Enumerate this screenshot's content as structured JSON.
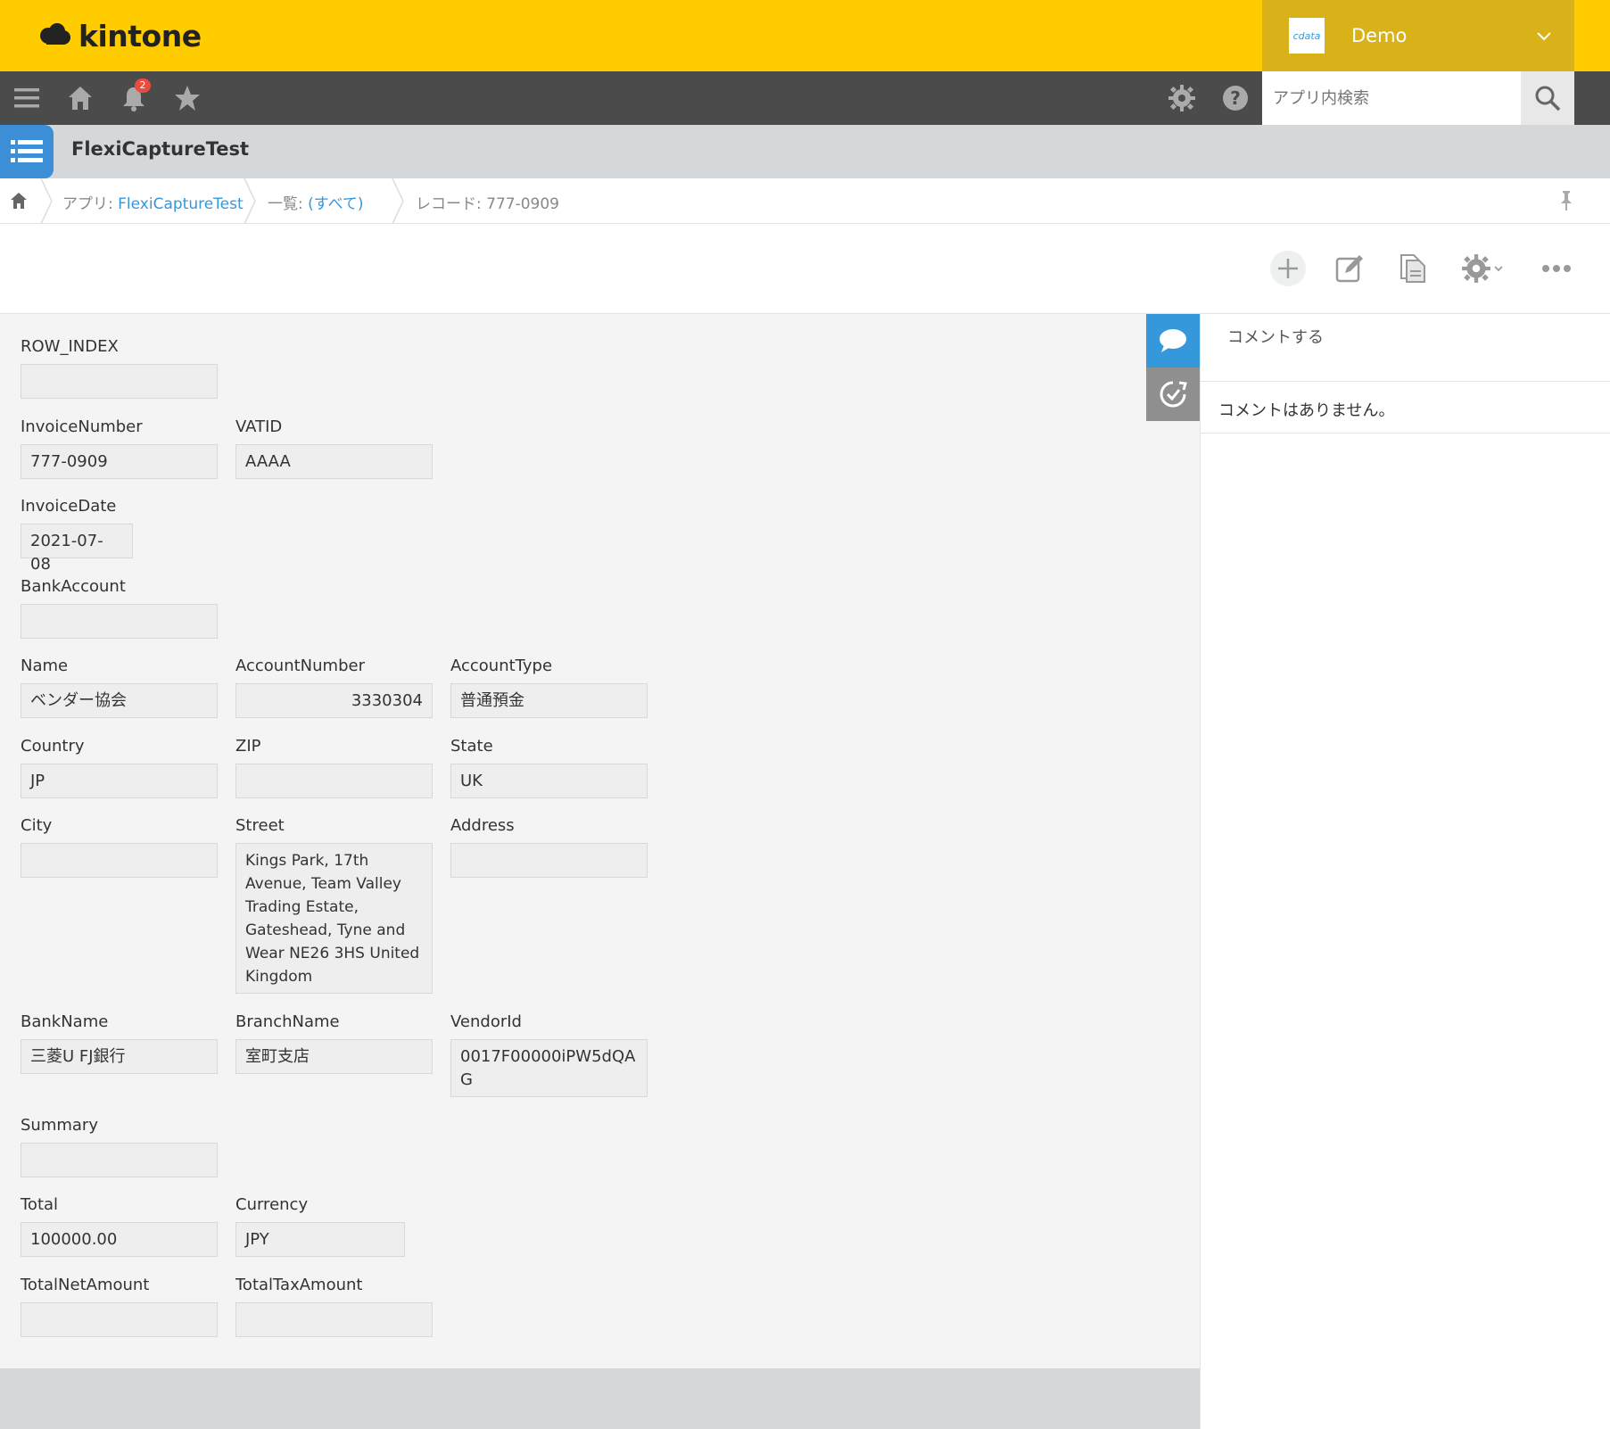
{
  "brand": {
    "name": "kintone"
  },
  "user": {
    "avatar_text": "cdata",
    "name": "Demo"
  },
  "nav": {
    "notification_count": "2"
  },
  "search": {
    "placeholder": "アプリ内検索"
  },
  "app": {
    "title": "FlexiCaptureTest"
  },
  "breadcrumb": {
    "app_prefix": "アプリ: ",
    "app_name": "FlexiCaptureTest",
    "list_prefix": "一覧: ",
    "list_name": "(すべて)",
    "record": "レコード: 777-0909"
  },
  "fields": {
    "row_index": {
      "label": "ROW_INDEX",
      "value": ""
    },
    "invoice_number": {
      "label": "InvoiceNumber",
      "value": "777-0909"
    },
    "vatid": {
      "label": "VATID",
      "value": "AAAA"
    },
    "invoice_date": {
      "label": "InvoiceDate",
      "value": "2021-07-08"
    },
    "bank_account": {
      "label": "BankAccount",
      "value": ""
    },
    "name": {
      "label": "Name",
      "value": "ベンダー協会"
    },
    "account_number": {
      "label": "AccountNumber",
      "value": "3330304"
    },
    "account_type": {
      "label": "AccountType",
      "value": "普通預金"
    },
    "country": {
      "label": "Country",
      "value": "JP"
    },
    "zip": {
      "label": "ZIP",
      "value": ""
    },
    "state": {
      "label": "State",
      "value": "UK"
    },
    "city": {
      "label": "City",
      "value": ""
    },
    "street": {
      "label": "Street",
      "value": "Kings Park, 17th Avenue, Team Valley Trading Estate, Gateshead, Tyne and Wear NE26 3HS United Kingdom"
    },
    "address": {
      "label": "Address",
      "value": ""
    },
    "bank_name": {
      "label": "BankName",
      "value": "三菱U FJ銀行"
    },
    "branch_name": {
      "label": "BranchName",
      "value": "室町支店"
    },
    "vendor_id": {
      "label": "VendorId",
      "value": "0017F00000iPW5dQAG"
    },
    "summary": {
      "label": "Summary",
      "value": ""
    },
    "total": {
      "label": "Total",
      "value": "100000.00"
    },
    "currency": {
      "label": "Currency",
      "value": "JPY"
    },
    "total_net_amount": {
      "label": "TotalNetAmount",
      "value": ""
    },
    "total_tax_amount": {
      "label": "TotalTaxAmount",
      "value": ""
    }
  },
  "comments": {
    "input_placeholder": "コメントする",
    "empty_message": "コメントはありません。"
  },
  "colors": {
    "brand_yellow": "#ffcc00",
    "navbar": "#4b4b4b",
    "accent_blue": "#3498db"
  }
}
